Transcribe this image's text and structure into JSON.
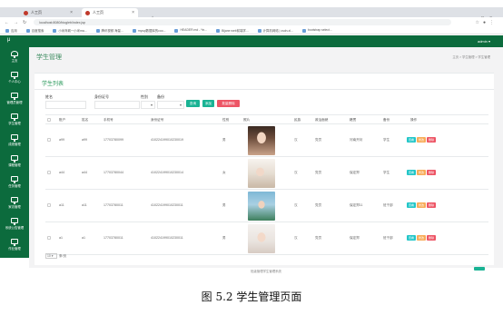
{
  "browser": {
    "tabs": [
      {
        "title": "人工页"
      },
      {
        "title": "人工页"
      }
    ],
    "address": "localhost:8080/biogleb/index.jsp",
    "bookmarks": [
      "应用",
      "百度搜索",
      "小米商城一小米ma...",
      "腾讯视频 海量...",
      "mysql数据库的coo...",
      "HEADER.md - *in...",
      "Bijane web前端学...",
      "计算机网络 | csdn-xl...",
      "bootstrap select..."
    ]
  },
  "app": {
    "logo": "μ",
    "user": "admin ▾"
  },
  "sidebar": {
    "items": [
      {
        "label": "主页",
        "icon": "home-icon"
      },
      {
        "label": "个人中心",
        "icon": "monitor-icon"
      },
      {
        "label": "管理员管理",
        "icon": "monitor-icon"
      },
      {
        "label": "学生管理",
        "icon": "monitor-icon"
      },
      {
        "label": "成绩管理",
        "icon": "monitor-icon"
      },
      {
        "label": "课程管理",
        "icon": "monitor-icon"
      },
      {
        "label": "任务管理",
        "icon": "monitor-icon"
      },
      {
        "label": "家访管理",
        "icon": "monitor-icon"
      },
      {
        "label": "系统公告管理",
        "icon": "monitor-icon"
      },
      {
        "label": "作业管理",
        "icon": "monitor-icon"
      }
    ]
  },
  "page": {
    "title": "学生管理",
    "breadcrumb": "主页  >  学生管理  >  学生管理"
  },
  "card": {
    "title": "学生列表"
  },
  "filters": {
    "name_label": "姓名",
    "id_label": "身份证号",
    "gender_label": "性别",
    "class_label": "备份",
    "search_button": "查询",
    "add_button": "添加",
    "bulk_delete_button": "批量删除"
  },
  "table": {
    "headers": [
      "账户",
      "姓名",
      "手机号",
      "身份证号",
      "性别",
      "照片",
      "民族",
      "政治面貌",
      "籍贯",
      "备份",
      "操作"
    ],
    "rows": [
      {
        "account": "a99",
        "name": "a99",
        "phone": "17703780099",
        "idcard": "410224199010230019",
        "gender": "男",
        "ethnicity": "汉",
        "politics": "党员",
        "origin": "河南开封",
        "note": "学生",
        "photo": "photo-1"
      },
      {
        "account": "a44",
        "name": "a44",
        "phone": "17703780044",
        "idcard": "410224199010230014",
        "gender": "女",
        "ethnicity": "汉",
        "politics": "党员",
        "origin": "保定郑",
        "note": "学生",
        "photo": "photo-2"
      },
      {
        "account": "a11",
        "name": "a11",
        "phone": "17703780011",
        "idcard": "410224199010230011",
        "gender": "男",
        "ethnicity": "汉",
        "politics": "党员",
        "origin": "保定郑11",
        "note": "班干部",
        "photo": "photo-3"
      },
      {
        "account": "a1",
        "name": "a1",
        "phone": "17703780011",
        "idcard": "410224199010230011",
        "gender": "男",
        "ethnicity": "汉",
        "politics": "党员",
        "origin": "保定郑",
        "note": "班干部",
        "photo": "photo-4"
      }
    ],
    "actions": {
      "view": "查看",
      "edit": "修改",
      "delete": "删除"
    }
  },
  "pager": {
    "size": "10 ▾",
    "suffix": "条/页"
  },
  "footer": "班级管理学生管理系统",
  "caption": "图 5.2  学生管理页面",
  "colors": {
    "brand": "#0c6b3d",
    "primary": "#1ab394",
    "danger": "#ed5565",
    "warning": "#f8ac59",
    "info": "#23c6c8"
  }
}
